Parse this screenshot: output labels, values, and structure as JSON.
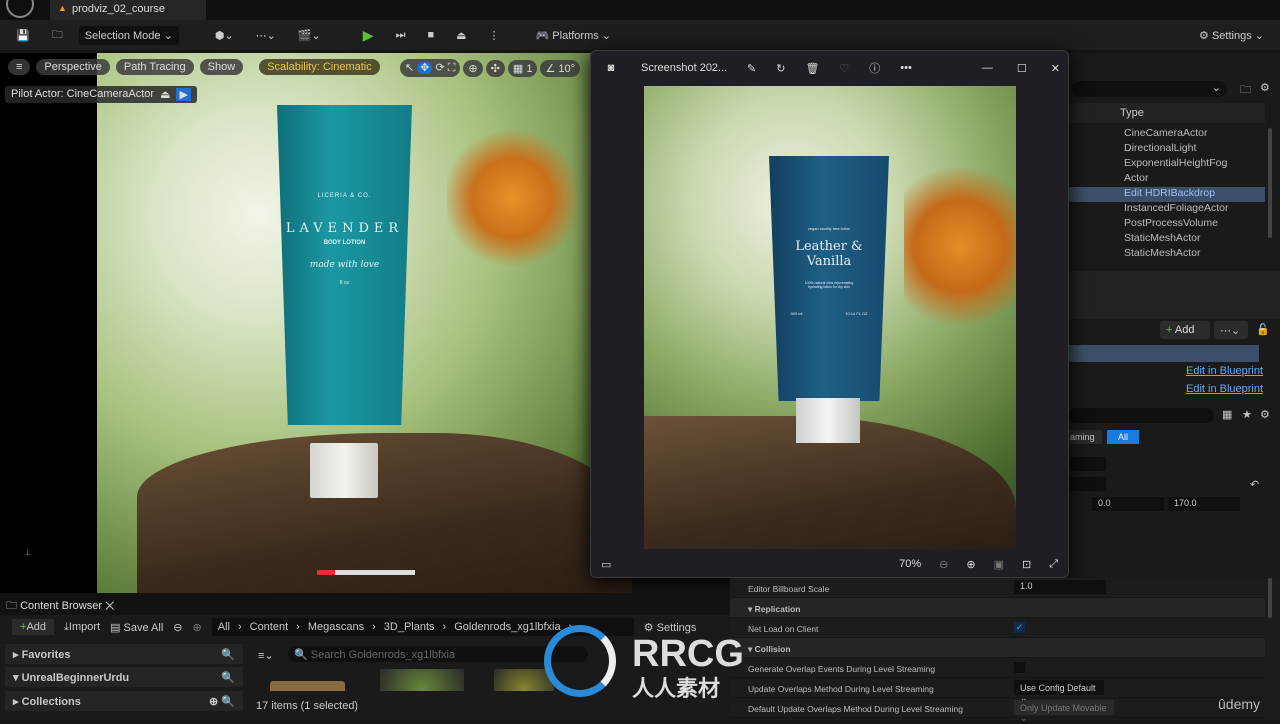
{
  "app": {
    "project_tab": "prodviz_02_course"
  },
  "toolbar": {
    "selection_mode": "Selection Mode",
    "platforms": "Platforms",
    "settings": "Settings"
  },
  "viewport": {
    "perspective": "Perspective",
    "path_tracing": "Path Tracing",
    "show": "Show",
    "scalability": "Scalability: Cinematic",
    "grid_value": "1",
    "angle_value": "10°",
    "pilot": "Pilot Actor: CineCameraActor",
    "product": {
      "brand": "LICERIA & CO.",
      "name": "LAVENDER",
      "sub": "BODY LOTION",
      "script": "made with love",
      "size": "8 oz"
    }
  },
  "photo_viewer": {
    "title": "Screenshot 202...",
    "zoom": "70%",
    "product": {
      "tagline": "vegan cruelty free lotion",
      "name1": "Leather &",
      "name2": "Vanilla",
      "desc1": "100% natural ultra-rejuvenating",
      "desc2": "hydrating lotion for dry skin",
      "vol": "300 ml",
      "floz": "10.14 FL OZ"
    }
  },
  "outliner": {
    "type_header": "Type",
    "rows": [
      "CineCameraActor",
      "DirectionalLight",
      "ExponentialHeightFog",
      "Actor",
      "Edit HDRIBackdrop",
      "InstancedFoliageActor",
      "PostProcessVolume",
      "StaticMeshActor",
      "StaticMeshActor"
    ],
    "selected_index": 4
  },
  "components": {
    "add": "Add",
    "edit_bp_1": "Edit in Blueprint",
    "edit_bp_2": "Edit in Blueprint"
  },
  "filters": {
    "streaming": "aming",
    "all": "All"
  },
  "transform": {
    "v1": "0.0",
    "v2": "170.0"
  },
  "details": {
    "billboard_label": "Editor Billboard Scale",
    "billboard_value": "1.0",
    "replication": "Replication",
    "net_load": "Net Load on Client",
    "net_load_checked": true,
    "collision": "Collision",
    "gen_overlap": "Generate Overlap Events During Level Streaming",
    "gen_overlap_checked": false,
    "update_overlaps": "Update Overlaps Method During Level Streaming",
    "update_overlaps_value": "Use Config Default",
    "default_update": "Default Update Overlaps Method During Level Streaming",
    "default_update_value": "Only Update Movable"
  },
  "content_browser": {
    "tab": "Content Browser",
    "add": "Add",
    "import": "Import",
    "save_all": "Save All",
    "breadcrumb": [
      "All",
      "Content",
      "Megascans",
      "3D_Plants",
      "Goldenrods_xg1lbfxia"
    ],
    "settings": "Settings",
    "search_placeholder": "Search Goldenrods_xg1lbfxia",
    "favorites": "Favorites",
    "project": "UnrealBeginnerUrdu",
    "collections": "Collections",
    "status": "17 items (1 selected)"
  },
  "watermark": {
    "text": "RRCG",
    "sub": "人人素材",
    "udemy": "ûdemy"
  }
}
